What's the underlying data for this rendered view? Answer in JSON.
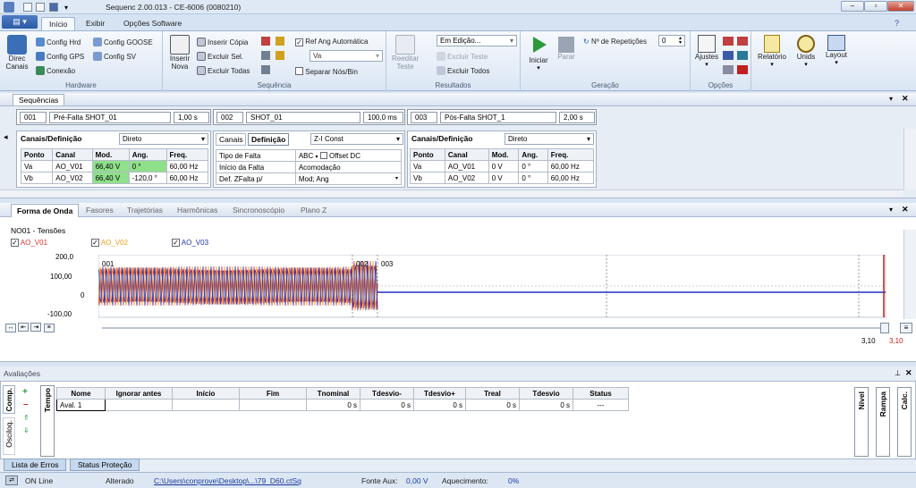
{
  "window": {
    "title": "Sequenc 2.00.013 - CE-6006 (0080210)"
  },
  "ribbon": {
    "tabs": [
      "Início",
      "Exibir",
      "Opções Software"
    ],
    "hardware": {
      "direc_canais": "Direc Canais",
      "config_hrd": "Config Hrd",
      "config_goose": "Config GOOSE",
      "config_gps": "Config GPS",
      "config_sv": "Config SV",
      "conexao": "Conexão",
      "group": "Hardware"
    },
    "sequencia": {
      "inserir_nova": "Inserir Nova",
      "inserir_copia": "Inserir Cópia",
      "excluir_sel": "Excluir Sel.",
      "excluir_todas": "Excluir Todas",
      "ref_ang": "Ref Ang Automática",
      "ref_value": "Va",
      "separar": "Separar Nós/Bin",
      "group": "Sequência"
    },
    "resultados": {
      "reeditar": "Reeditar Teste",
      "status": "Em Edição...",
      "excluir_teste": "Excluir Teste",
      "excluir_todos": "Excluir Todos",
      "group": "Resultados"
    },
    "geracao": {
      "iniciar": "Iniciar",
      "parar": "Parar",
      "repeticoes_label": "Nº de Repetições",
      "repeticoes_value": "0",
      "group": "Geração"
    },
    "opcoes": {
      "ajustes": "Ajustes",
      "group": "Opções"
    },
    "extra": {
      "relatorio": "Relatório",
      "unids": "Unids",
      "layout": "Layout"
    }
  },
  "sequences": {
    "tab": "Sequências",
    "items": [
      {
        "num": "001",
        "name": "Pré-Falta SHOT_01",
        "time": "1,00 s"
      },
      {
        "num": "002",
        "name": "SHOT_01",
        "time": "100,0 ms"
      },
      {
        "num": "003",
        "name": "Pós-Falta SHOT_1",
        "time": "2,00 s"
      }
    ]
  },
  "channels1": {
    "title": "Canais/Definição",
    "mode": "Direto",
    "headers": [
      "Ponto",
      "Canal",
      "Mod.",
      "Ang.",
      "Freq."
    ],
    "rows": [
      [
        "Va",
        "AO_V01",
        "66,40 V",
        "0 °",
        "60,00 Hz"
      ],
      [
        "Vb",
        "AO_V02",
        "66,40 V",
        "-120,0 °",
        "60,00 Hz"
      ]
    ]
  },
  "channels2": {
    "tab1": "Canais",
    "tab2": "Definição",
    "mode": "Z-I Const",
    "rows": [
      {
        "label": "Tipo de Falta",
        "value": "ABC",
        "check": "Offset DC"
      },
      {
        "label": "Início da Falta",
        "value": "Acomodação"
      },
      {
        "label": "Def. ZFalta p/",
        "value": "Mod; Ang"
      }
    ]
  },
  "channels3": {
    "title": "Canais/Definição",
    "mode": "Direto",
    "headers": [
      "Ponto",
      "Canal",
      "Mod.",
      "Ang.",
      "Freq."
    ],
    "rows": [
      [
        "Va",
        "AO_V01",
        "0 V",
        "0 °",
        "60,00 Hz"
      ],
      [
        "Vb",
        "AO_V02",
        "0 V",
        "0 °",
        "60,00 Hz"
      ]
    ]
  },
  "waveform": {
    "tabs": [
      "Forma de Onda",
      "Fasores",
      "Trajetórias",
      "Harmônicas",
      "Sincronoscópio",
      "Plano Z"
    ],
    "group_title": "NO01 - Tensões",
    "channels": [
      {
        "name": "AO_V01",
        "color": "#e03030"
      },
      {
        "name": "AO_V02",
        "color": "#f0a020"
      },
      {
        "name": "AO_V03",
        "color": "#2030c0"
      }
    ],
    "yticks": [
      "200,0",
      "100,00",
      "0",
      "-100,00"
    ],
    "markers": [
      "001",
      "002",
      "003"
    ],
    "cursor1": "3,10",
    "cursor2": "3,10"
  },
  "avaliacoes": {
    "title": "Avaliações",
    "side_tabs": [
      "Comp.",
      "Osciloq."
    ],
    "tempo": "Tempo",
    "headers": [
      "Nome",
      "Ignorar antes",
      "Início",
      "Fim",
      "Tnominal",
      "Tdesvio-",
      "Tdesvio+",
      "Treal",
      "Tdesvio",
      "Status"
    ],
    "row": [
      "Aval. 1",
      "",
      "",
      "",
      "0 s",
      "0 s",
      "0 s",
      "0 s",
      "0 s",
      "---"
    ],
    "right_tabs": [
      "Nível",
      "Rampa",
      "Calc."
    ],
    "bottom_tabs": [
      "Lista de Erros",
      "Status Proteção"
    ]
  },
  "status": {
    "online": "ON Line",
    "state": "Alterado",
    "file": "C:\\Users\\conprove\\Desktop\\...\\79_D60.ctSq",
    "fonte_label": "Fonte Aux:",
    "fonte_value": "0,00 V",
    "aquec_label": "Aquecimento:",
    "aquec_value": "0%"
  }
}
